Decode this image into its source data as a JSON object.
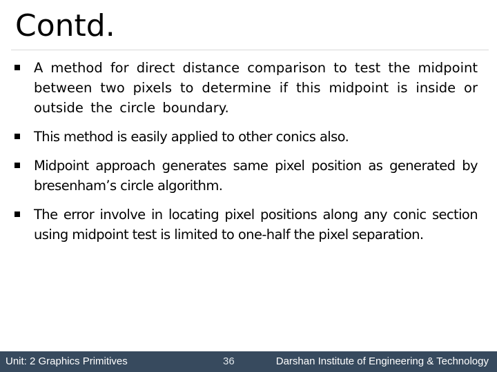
{
  "slide": {
    "title": "Contd.",
    "bullets": [
      {
        "text": "A method for direct distance comparison to test the midpoint between two pixels to determine if this midpoint is inside or outside the circle boundary."
      },
      {
        "text": "This method is easily applied to other conics also."
      },
      {
        "text": "Midpoint approach generates same pixel position as generated by bresenham’s circle algorithm."
      },
      {
        "text": "The error involve in locating pixel positions along any conic section using midpoint test is limited to one-half the pixel separation."
      }
    ],
    "bullet_icon": "square-bullet-icon"
  },
  "footer": {
    "unit": "Unit: 2 Graphics Primitives",
    "page_number": "36",
    "institute": "Darshan Institute of Engineering & Technology",
    "background_color": "#374a5e"
  }
}
